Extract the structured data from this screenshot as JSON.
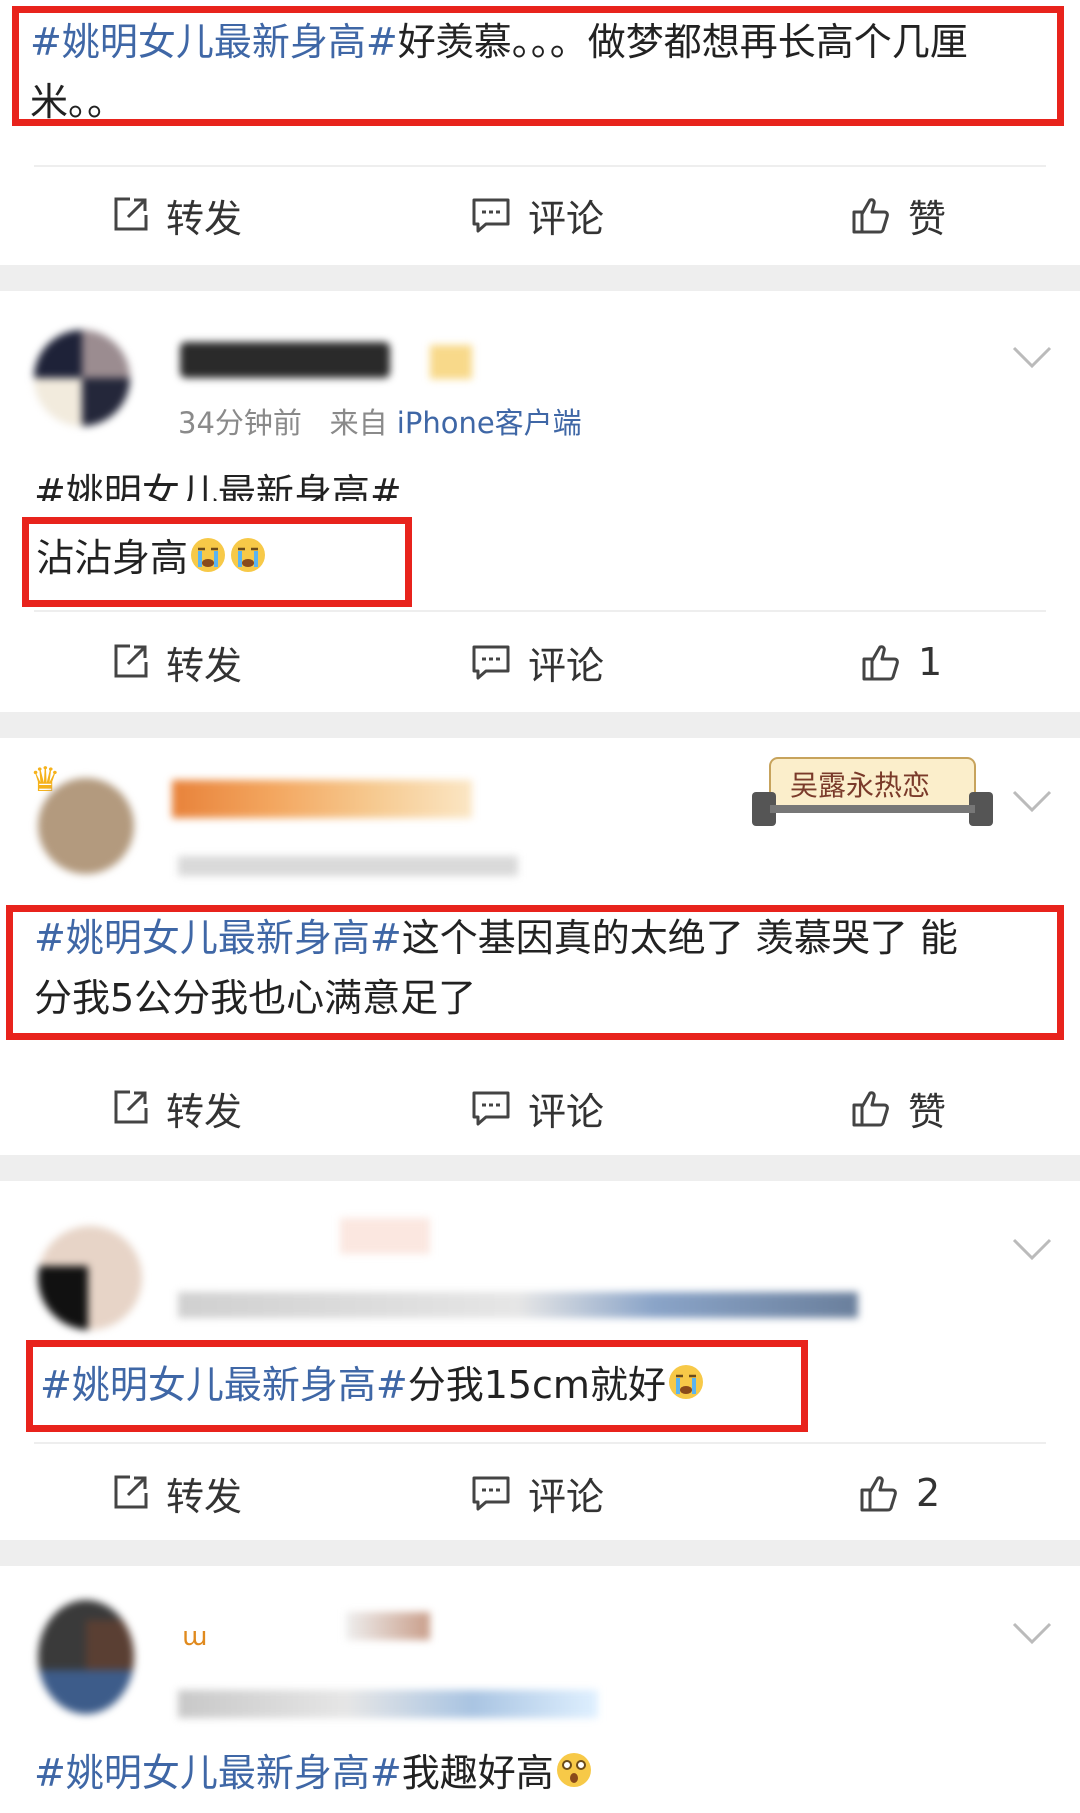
{
  "post1": {
    "hashtag": "#姚明女儿最新身高#",
    "text": "好羡慕。。。做梦都想再长高个几厘",
    "text_cont": "米。。"
  },
  "actions": {
    "repost": "转发",
    "comment": "评论",
    "like": "赞"
  },
  "post2": {
    "time": "34分钟前",
    "from_prefix": "来自",
    "source": "iPhone客户端",
    "hashtag": "#姚明女儿最新身高#",
    "text": "沾沾身高",
    "like_count": "1"
  },
  "post3": {
    "badge_text": "吴露永热恋",
    "hashtag": "#姚明女儿最新身高#",
    "text": "这个基因真的太绝了 羡慕哭了 能",
    "text_cont": "分我5公分我也心满意足了"
  },
  "post4": {
    "hashtag": "#姚明女儿最新身高#",
    "text": "分我15cm就好",
    "like_count": "2"
  },
  "post5": {
    "hashtag": "#姚明女儿最新身高#",
    "text": "我趣好高"
  },
  "colors": {
    "highlight_box": "#e8231c",
    "hashtag": "#3f67a6",
    "separator": "#eeeeee"
  }
}
